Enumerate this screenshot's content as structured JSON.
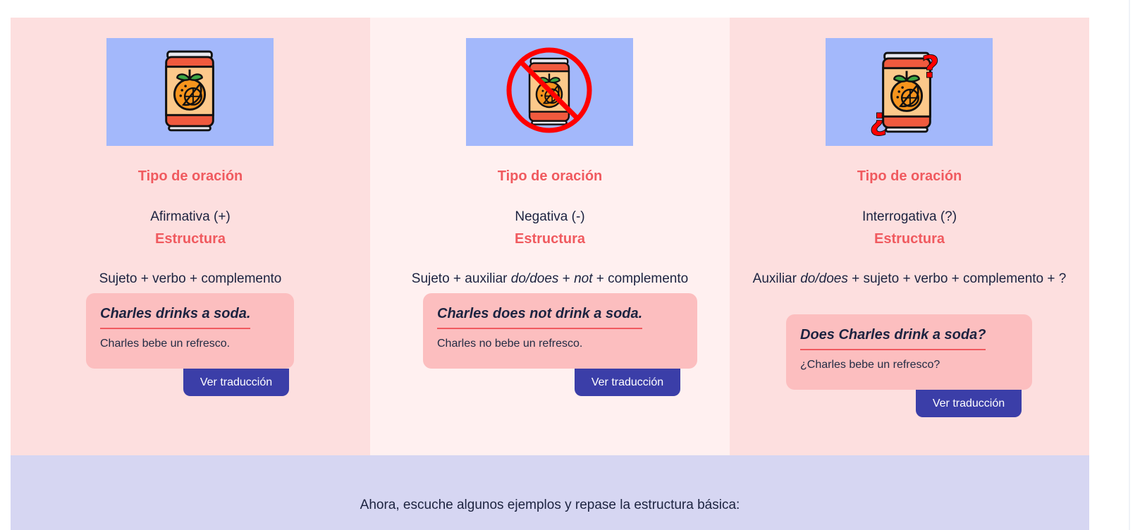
{
  "columns": [
    {
      "type_label": "Tipo de oración",
      "type_value": "Afirmativa (+)",
      "structure_label": "Estructura",
      "structure": [
        "Sujeto + verbo + complemento"
      ],
      "example": "Charles drinks a soda.",
      "translation": "Charles bebe un refresco.",
      "button": "Ver traducción",
      "image_icon": "soda-can-icon"
    },
    {
      "type_label": "Tipo de oración",
      "type_value": "Negativa (-)",
      "structure_label": "Estructura",
      "structure": [
        "Sujeto + auxiliar ",
        "do/does",
        " + ",
        "not",
        " + complemento"
      ],
      "example": "Charles does not drink a soda.",
      "translation": "Charles no bebe un refresco.",
      "button": "Ver traducción",
      "image_icon": "prohibited-soda-can-icon"
    },
    {
      "type_label": "Tipo de oración",
      "type_value": "Interrogativa (?)",
      "structure_label": "Estructura",
      "structure": [
        "Auxiliar ",
        "do/does",
        " + sujeto + verbo + complemento + ?"
      ],
      "example": "Does Charles drink a soda?",
      "translation": "¿Charles bebe un refresco?",
      "button": "Ver traducción",
      "image_icon": "question-soda-can-icon"
    }
  ],
  "footer": {
    "text": "Ahora, escuche algunos ejemplos y repase la estructura básica:"
  },
  "colors": {
    "accent_red": "#f05a5f",
    "button_blue": "#3b3ea8",
    "image_bg": "#a3b8fb",
    "card_bg": "#fcbebf",
    "footer_bg": "#d6d6f2"
  }
}
